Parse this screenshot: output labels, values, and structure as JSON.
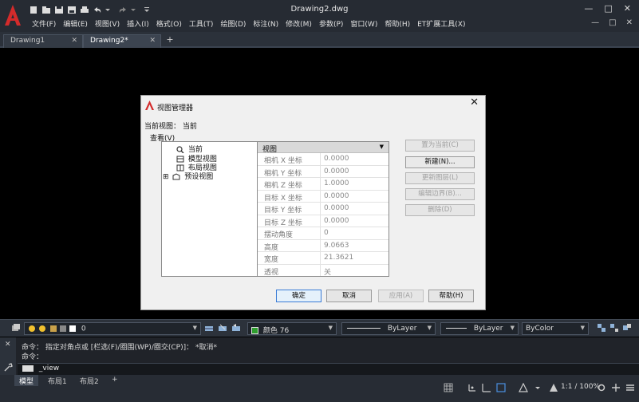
{
  "window": {
    "title": "Drawing2.dwg",
    "controls": [
      "—",
      "□",
      "✕"
    ]
  },
  "menu": {
    "items": [
      "文件(F)",
      "编辑(E)",
      "视图(V)",
      "插入(I)",
      "格式(O)",
      "工具(T)",
      "绘图(D)",
      "标注(N)",
      "修改(M)",
      "参数(P)",
      "窗口(W)",
      "帮助(H)",
      "ET扩展工具(X)"
    ],
    "right_controls": [
      "—",
      "□",
      "✕"
    ]
  },
  "tabs": [
    {
      "label": "Drawing1",
      "close": "✕"
    },
    {
      "label": "Drawing2*",
      "close": "✕"
    }
  ],
  "new_tab": "+",
  "dialog": {
    "title": "视图管理器",
    "close": "✕",
    "current_view": "当前视图：  当前",
    "lookup": "查看(V)",
    "tree": [
      "当前",
      "模型视图",
      "布局视图",
      "预设视图"
    ],
    "tree_expander": "⊞",
    "props_header": "视图",
    "props": [
      {
        "k": "相机 X 坐标",
        "v": "0.0000"
      },
      {
        "k": "相机 Y 坐标",
        "v": "0.0000"
      },
      {
        "k": "相机 Z 坐标",
        "v": "1.0000"
      },
      {
        "k": "目标 X 坐标",
        "v": "0.0000"
      },
      {
        "k": "目标 Y 坐标",
        "v": "0.0000"
      },
      {
        "k": "目标 Z 坐标",
        "v": "0.0000"
      },
      {
        "k": "摆动角度",
        "v": "0"
      },
      {
        "k": "高度",
        "v": "9.0663"
      },
      {
        "k": "宽度",
        "v": "21.3621"
      },
      {
        "k": "透视",
        "v": "关"
      }
    ],
    "right_buttons": [
      {
        "label": "置为当前(C)",
        "enabled": false
      },
      {
        "label": "新建(N)...",
        "enabled": true
      },
      {
        "label": "更新图层(L)",
        "enabled": false
      },
      {
        "label": "编辑边界(B)...",
        "enabled": false
      },
      {
        "label": "删除(D)",
        "enabled": false
      }
    ],
    "ok": "确定",
    "cancel": "取消",
    "apply": "应用(A)",
    "help": "帮助(H)"
  },
  "layerbar": {
    "layer": "0",
    "color": "颜色 76",
    "linetype": "ByLayer",
    "lineweight": "ByLayer",
    "plotstyle": "ByColor"
  },
  "command": {
    "history_1": "命令： 指定对角点或 [栏选(F)/圈围(WP)/圈交(CP)]： *取消*",
    "history_2": "命令：",
    "input": "_view"
  },
  "status": {
    "tabs": [
      "模型",
      "布局1",
      "布局2"
    ],
    "add": "+",
    "zoom": "1:1 / 100%"
  },
  "colors": {
    "accent_red": "#d42b2b",
    "layer_color": "#2f9e2f"
  }
}
